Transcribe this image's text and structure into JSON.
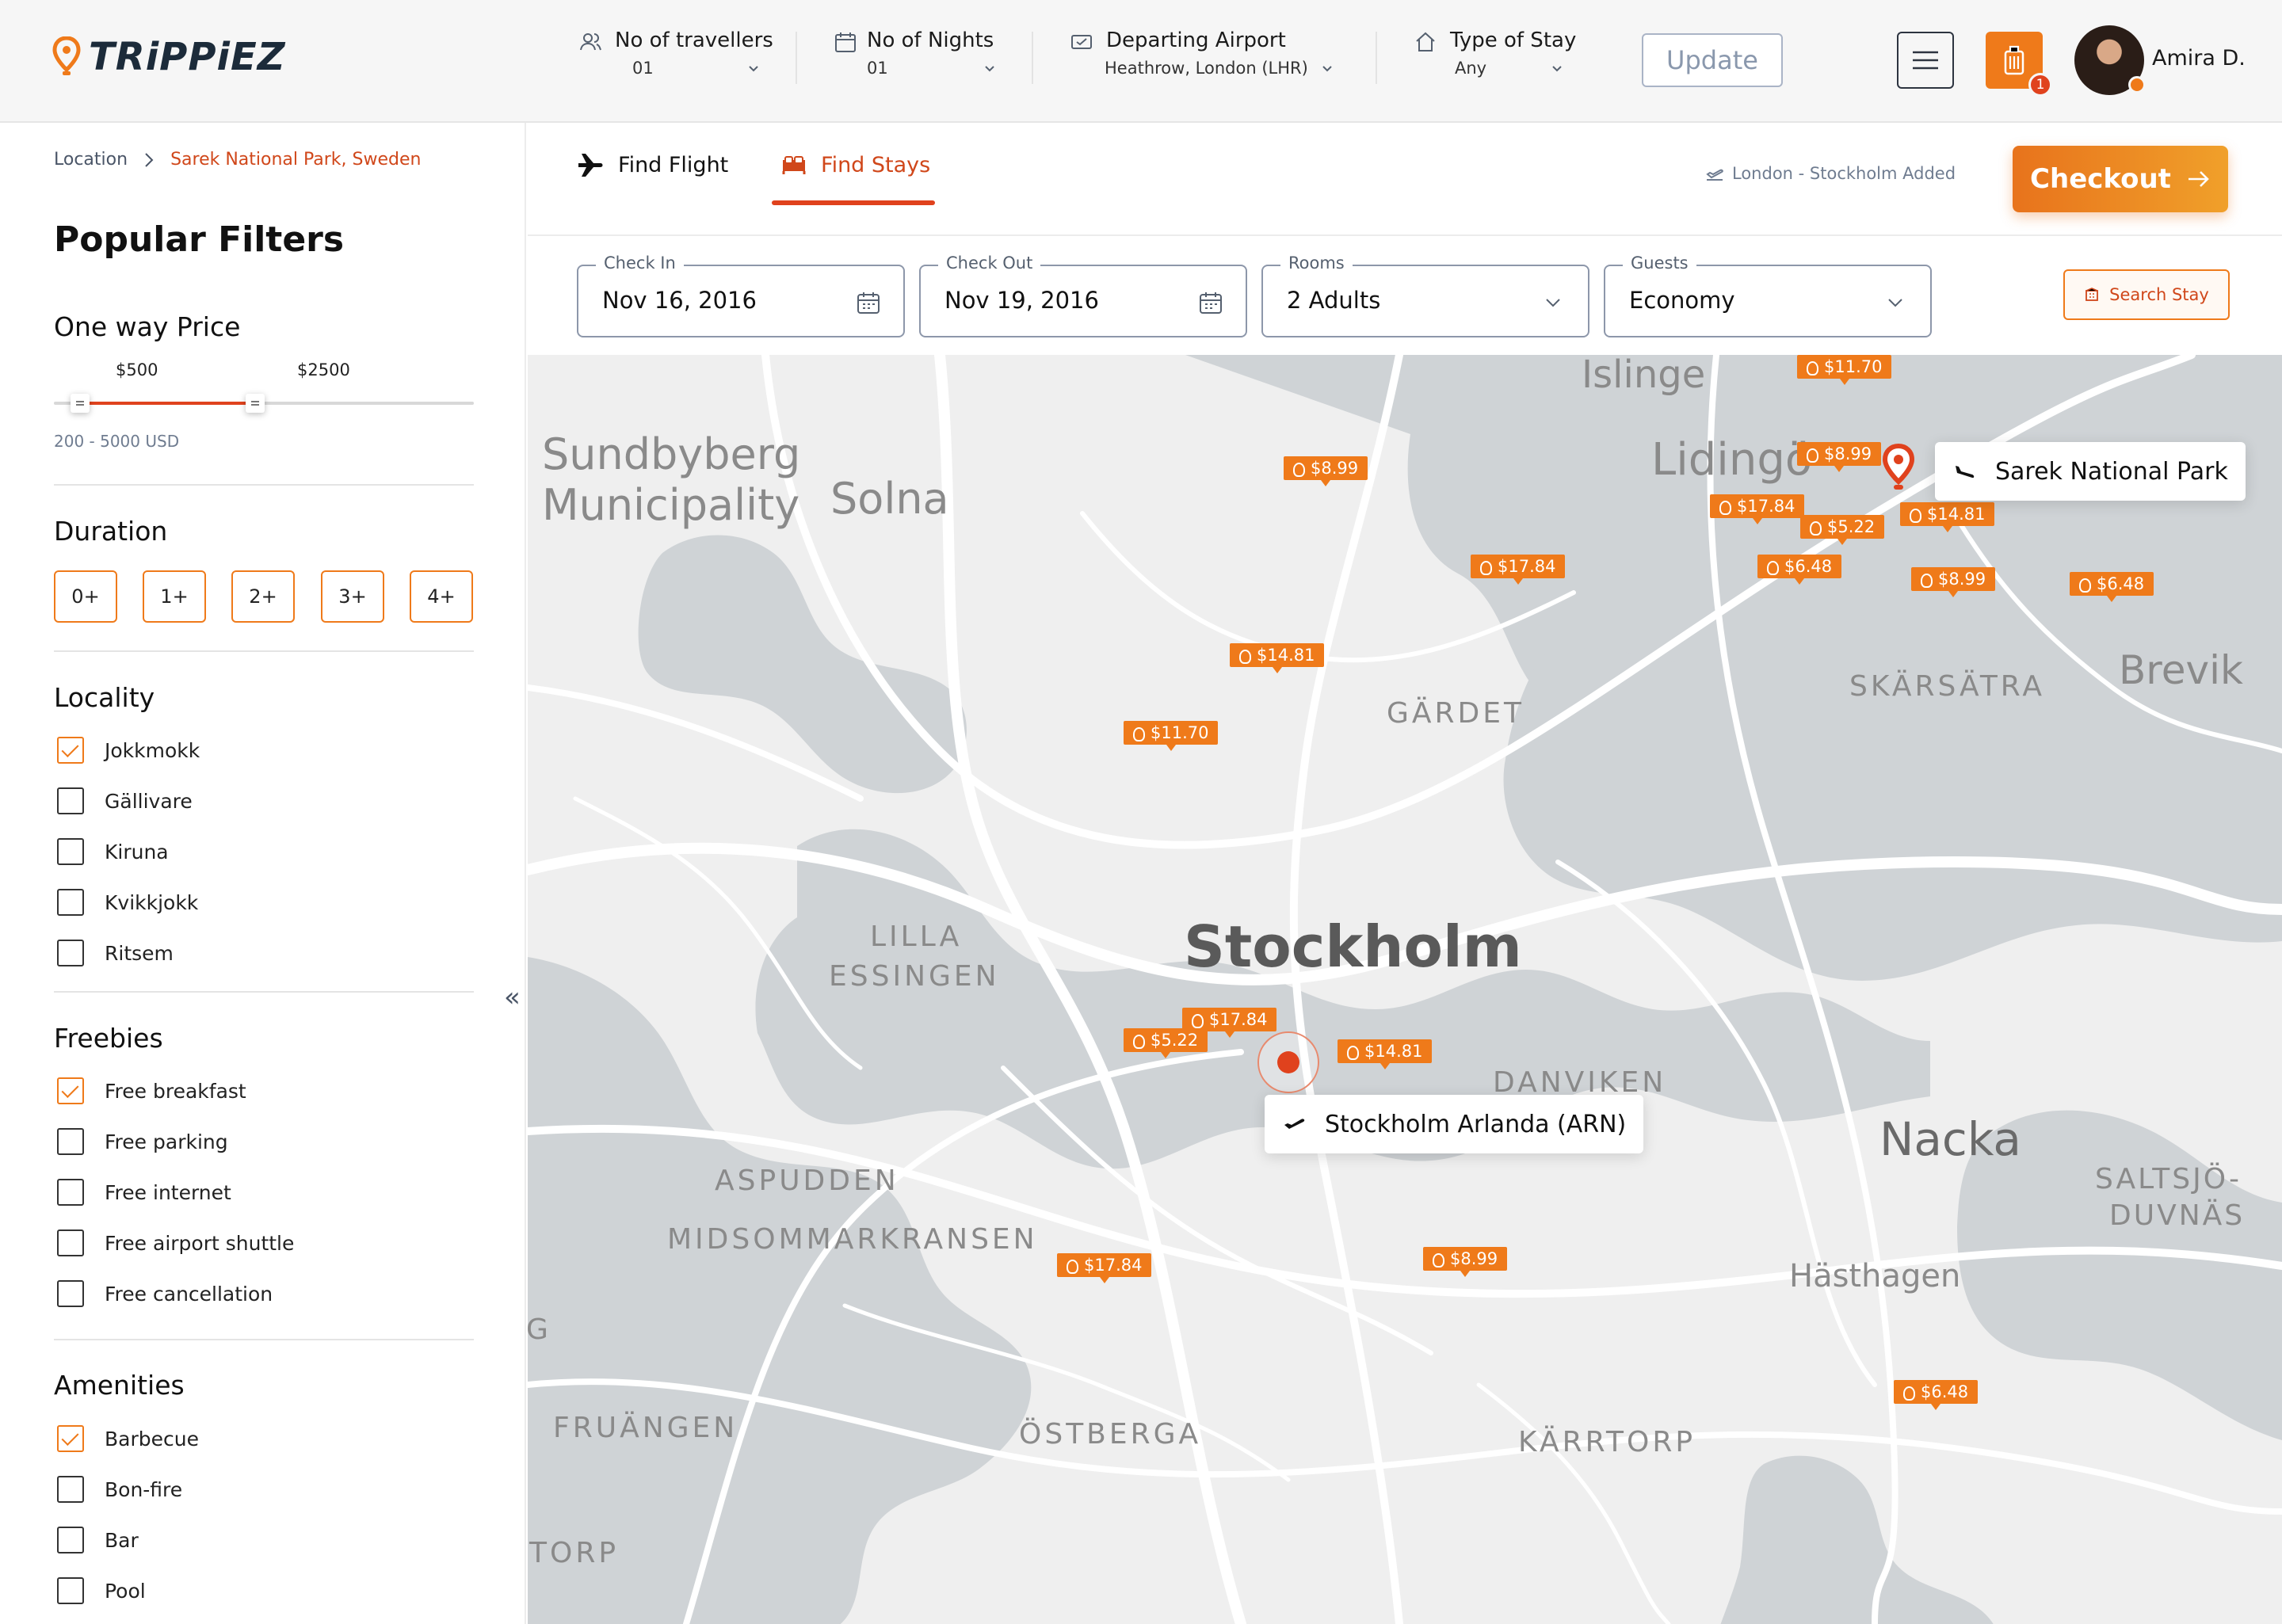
{
  "brand": {
    "name": "TRiPPiEZ"
  },
  "header": {
    "travellers": {
      "label": "No of travellers",
      "value": "01"
    },
    "nights": {
      "label": "No of Nights",
      "value": "01"
    },
    "airport": {
      "label": "Departing Airport",
      "value": "Heathrow, London (LHR)"
    },
    "stay_type": {
      "label": "Type of Stay",
      "value": "Any"
    },
    "update_label": "Update",
    "trip_count": "1",
    "user_name": "Amira D."
  },
  "breadcrumb": {
    "root": "Location",
    "current": "Sarek National Park, Sweden"
  },
  "filters": {
    "title": "Popular Filters",
    "price": {
      "title": "One way Price",
      "min_label": "$500",
      "max_label": "$2500",
      "range_note": "200 - 5000 USD",
      "min_value": 500,
      "max_value": 2500,
      "range_min": 200,
      "range_max": 5000
    },
    "duration": {
      "title": "Duration",
      "options": [
        "0+",
        "1+",
        "2+",
        "3+",
        "4+"
      ]
    },
    "locality": {
      "title": "Locality",
      "items": [
        {
          "label": "Jokkmokk",
          "checked": true
        },
        {
          "label": "Gällivare",
          "checked": false
        },
        {
          "label": "Kiruna",
          "checked": false
        },
        {
          "label": "Kvikkjokk",
          "checked": false
        },
        {
          "label": "Ritsem",
          "checked": false
        }
      ]
    },
    "freebies": {
      "title": "Freebies",
      "items": [
        {
          "label": "Free breakfast",
          "checked": true
        },
        {
          "label": "Free parking",
          "checked": false
        },
        {
          "label": "Free internet",
          "checked": false
        },
        {
          "label": "Free airport shuttle",
          "checked": false
        },
        {
          "label": "Free cancellation",
          "checked": false
        }
      ]
    },
    "amenities": {
      "title": "Amenities",
      "items": [
        {
          "label": "Barbecue",
          "checked": true
        },
        {
          "label": "Bon-fire",
          "checked": false
        },
        {
          "label": "Bar",
          "checked": false
        },
        {
          "label": "Pool",
          "checked": false
        }
      ]
    }
  },
  "tabs": {
    "flight": "Find Flight",
    "stays": "Find Stays"
  },
  "added_note": "London - Stockholm Added",
  "checkout_label": "Checkout",
  "search": {
    "check_in": {
      "label": "Check In",
      "value": "Nov 16, 2016"
    },
    "check_out": {
      "label": "Check Out",
      "value": "Nov 19, 2016"
    },
    "rooms": {
      "label": "Rooms",
      "value": "2 Adults"
    },
    "guests": {
      "label": "Guests",
      "value": "Economy"
    },
    "button": "Search Stay"
  },
  "map": {
    "labels": [
      "Sundbyberg",
      "Municipality",
      "Solna",
      "Islinge",
      "Lidingö",
      "Brevik",
      "SKÄRSÄTRA",
      "GÄRDET",
      "LILLA",
      "ESSINGEN",
      "Stockholm",
      "DANVIKEN",
      "Nacka",
      "SALTSJÖ-",
      "DUVNÄS",
      "ASPUDDEN",
      "MIDSOMMARKRANSEN",
      "Hästhagen",
      "FRUÄNGEN",
      "ÖSTBERGA",
      "KÄRRTORP",
      "TORP",
      "G"
    ],
    "price_pins": [
      "$11.70",
      "$8.99",
      "$8.99",
      "$17.84",
      "$5.22",
      "$14.81",
      "$17.84",
      "$6.48",
      "$8.99",
      "$6.48",
      "$14.81",
      "$11.70",
      "$17.84",
      "$5.22",
      "$14.81",
      "$17.84",
      "$8.99",
      "$6.48"
    ],
    "destination": "Sarek National Park",
    "origin": "Stockholm Arlanda (ARN)"
  }
}
